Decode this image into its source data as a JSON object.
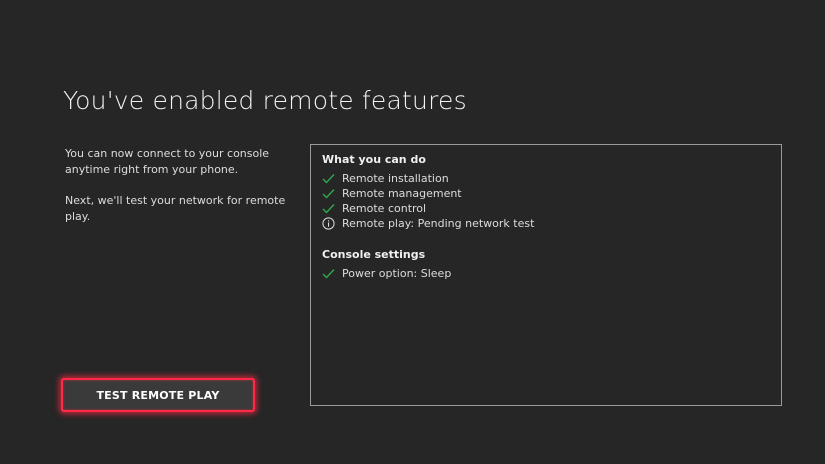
{
  "page": {
    "title": "You've enabled remote features",
    "intro_line1": "You can now connect to your console anytime right from your phone.",
    "intro_line2": "Next, we'll test your network for remote play."
  },
  "panel": {
    "section1_heading": "What you can do",
    "section1_items": [
      {
        "label": "Remote installation",
        "icon": "check-icon"
      },
      {
        "label": "Remote management",
        "icon": "check-icon"
      },
      {
        "label": "Remote control",
        "icon": "check-icon"
      },
      {
        "label": "Remote play: Pending network test",
        "icon": "info-icon"
      }
    ],
    "section2_heading": "Console settings",
    "section2_items": [
      {
        "label": "Power option: Sleep",
        "icon": "check-icon"
      }
    ]
  },
  "button": {
    "label": "TEST REMOTE PLAY"
  },
  "colors": {
    "background": "#262626",
    "check": "#2fa84f",
    "focus_glow": "#ff2a45"
  }
}
